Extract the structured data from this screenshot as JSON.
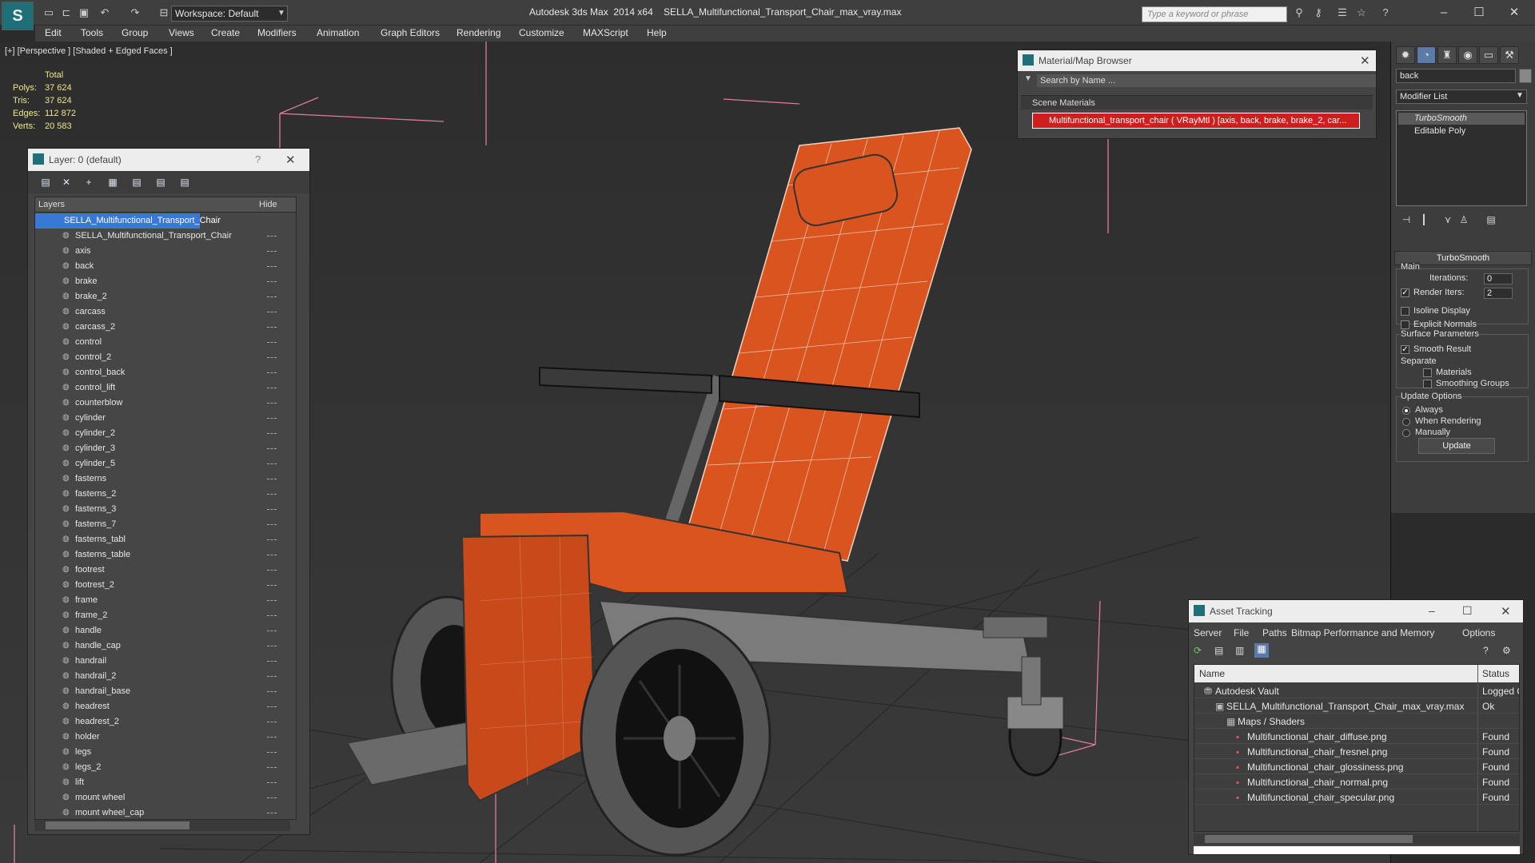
{
  "titlebar": {
    "app_title": "Autodesk 3ds Max  2014 x64",
    "file_title": "SELLA_Multifunctional_Transport_Chair_max_vray.max",
    "workspace": "Workspace: Default",
    "search_placeholder": "Type a keyword or phrase"
  },
  "menu": [
    "Edit",
    "Tools",
    "Group",
    "Views",
    "Create",
    "Modifiers",
    "Animation",
    "Graph Editors",
    "Rendering",
    "Customize",
    "MAXScript",
    "Help"
  ],
  "viewport": {
    "label": "[+] [Perspective ] [Shaded + Edged Faces ]",
    "stats": {
      "header": "Total",
      "polys_label": "Polys:",
      "polys": "37 624",
      "tris_label": "Tris:",
      "tris": "37 624",
      "edges_label": "Edges:",
      "edges": "112 872",
      "verts_label": "Verts:",
      "verts": "20 583"
    }
  },
  "layer_panel": {
    "title": "Layer: 0 (default)",
    "col_layers": "Layers",
    "col_hide": "Hide",
    "root": "SELLA_Multifunctional_Transport_Chair",
    "items": [
      "SELLA_Multifunctional_Transport_Chair",
      "axis",
      "back",
      "brake",
      "brake_2",
      "carcass",
      "carcass_2",
      "control",
      "control_2",
      "control_back",
      "control_lift",
      "counterblow",
      "cylinder",
      "cylinder_2",
      "cylinder_3",
      "cylinder_5",
      "fasterns",
      "fasterns_2",
      "fasterns_3",
      "fasterns_7",
      "fasterns_tabl",
      "fasterns_table",
      "footrest",
      "footrest_2",
      "frame",
      "frame_2",
      "handle",
      "handle_cap",
      "handrail",
      "handrail_2",
      "handrail_base",
      "headrest",
      "headrest_2",
      "holder",
      "legs",
      "legs_2",
      "lift",
      "mount wheel",
      "mount wheel_cap"
    ]
  },
  "material_browser": {
    "title": "Material/Map Browser",
    "search_placeholder": "Search by Name ...",
    "section": "Scene Materials",
    "item": "Multifunctional_transport_chair  ( VRayMtl )  [axis, back, brake, brake_2, car..."
  },
  "command_panel": {
    "object_name": "back",
    "modifier_list": "Modifier List",
    "stack": [
      "TurboSmooth",
      "Editable Poly"
    ],
    "rollout": "TurboSmooth",
    "main_label": "Main",
    "iterations_label": "Iterations:",
    "iterations": "0",
    "render_iters_label": "Render Iters:",
    "render_iters": "2",
    "isoline": "Isoline Display",
    "explicit_normals": "Explicit Normals",
    "surface_params": "Surface Parameters",
    "smooth_result": "Smooth Result",
    "separate": "Separate",
    "materials": "Materials",
    "smoothing_groups": "Smoothing Groups",
    "update_options": "Update Options",
    "always": "Always",
    "when_rendering": "When Rendering",
    "manually": "Manually",
    "update_btn": "Update"
  },
  "asset_tracking": {
    "title": "Asset Tracking",
    "menu": [
      "Server",
      "File",
      "Paths",
      "Bitmap Performance and Memory",
      "Options"
    ],
    "col_name": "Name",
    "col_status": "Status",
    "rows": [
      {
        "name": "Autodesk Vault",
        "status": "Logged O"
      },
      {
        "name": "SELLA_Multifunctional_Transport_Chair_max_vray.max",
        "status": "Ok"
      },
      {
        "name": "Maps / Shaders",
        "status": ""
      },
      {
        "name": "Multifunctional_chair_diffuse.png",
        "status": "Found"
      },
      {
        "name": "Multifunctional_chair_fresnel.png",
        "status": "Found"
      },
      {
        "name": "Multifunctional_chair_glossiness.png",
        "status": "Found"
      },
      {
        "name": "Multifunctional_chair_normal.png",
        "status": "Found"
      },
      {
        "name": "Multifunctional_chair_specular.png",
        "status": "Found"
      }
    ]
  },
  "colors": {
    "accent_orange": "#d9541e",
    "selection_blue": "#3a78d8",
    "material_red": "#cf1e1e",
    "stats_yellow": "#f0e68c"
  }
}
